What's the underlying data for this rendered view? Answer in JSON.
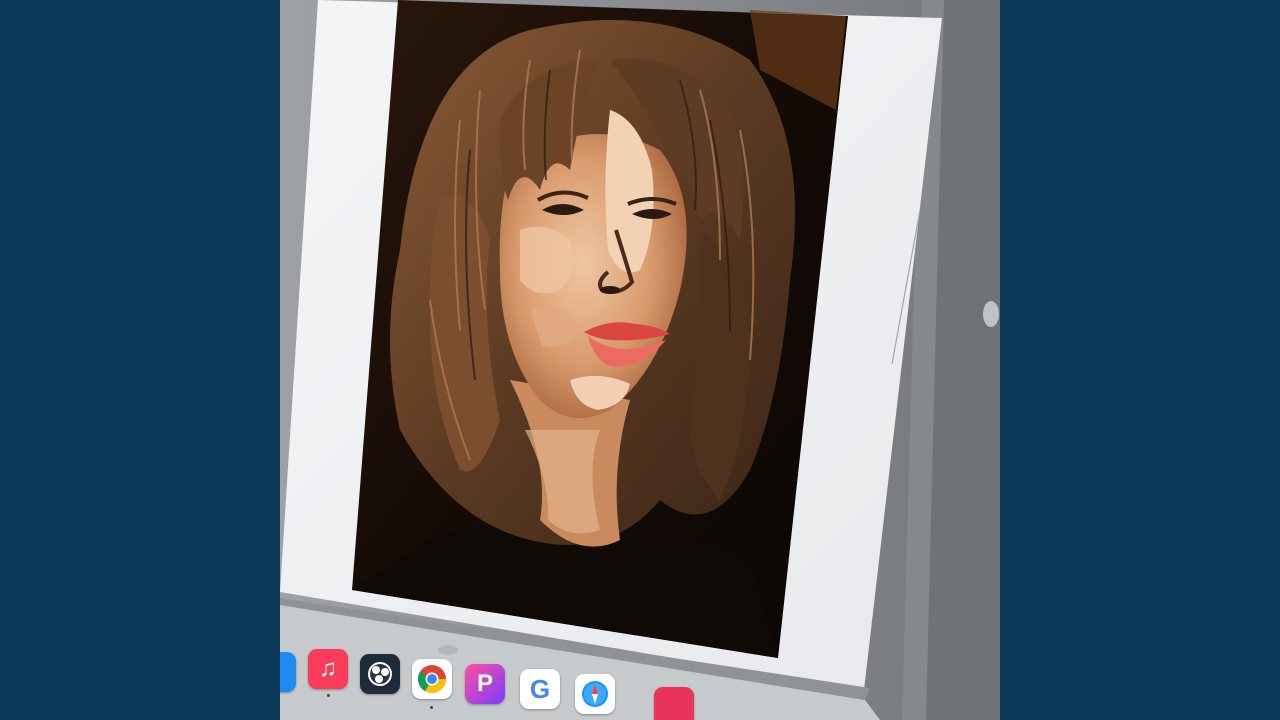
{
  "background_color": "#0e3a5a",
  "artwork": {
    "description_icon": "portrait-artwork",
    "colors": {
      "hair": "#5a3a22",
      "hair_light": "#9a6a45",
      "skin": "#e8b48c",
      "skin_shadow": "#c98d64",
      "lips": "#e4504e",
      "shirt": "#120c08",
      "backdrop": "#1a0f08"
    }
  },
  "dock": {
    "icons": [
      {
        "name": "app-store-icon",
        "color": "#1c8cf0"
      },
      {
        "name": "music-icon",
        "color": "#fa3c5a",
        "glyph": "♫"
      },
      {
        "name": "obs-icon",
        "color": "#1f2a3a"
      },
      {
        "name": "chrome-icon",
        "color": "#ffffff"
      },
      {
        "name": "picsart-icon",
        "color": "#a044e8",
        "glyph": "P"
      },
      {
        "name": "google-icon",
        "color": "#ffffff",
        "glyph": "G"
      },
      {
        "name": "safari-icon",
        "color": "#ffffff"
      },
      {
        "name": "app-icon-partial",
        "color": "#e8345a"
      }
    ]
  }
}
